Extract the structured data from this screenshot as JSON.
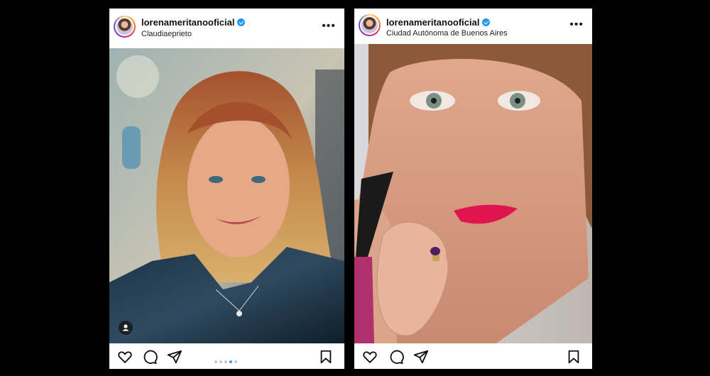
{
  "posts": [
    {
      "username": "lorenameritanooficial",
      "location": "Claudiaeprieto",
      "more_label": "•••",
      "carousel": {
        "total": 5,
        "active": 4
      }
    },
    {
      "username": "lorenameritanooficial",
      "location": "Ciudad Autónoma de Buenos Aires",
      "more_label": "•••"
    }
  ],
  "icons": [
    "heart-icon",
    "comment-icon",
    "share-icon",
    "bookmark-icon",
    "user-tag-icon",
    "verified-icon"
  ],
  "colors": {
    "background": "#000000",
    "verified": "#1d9bf0",
    "carousel_active": "#3897f0"
  }
}
